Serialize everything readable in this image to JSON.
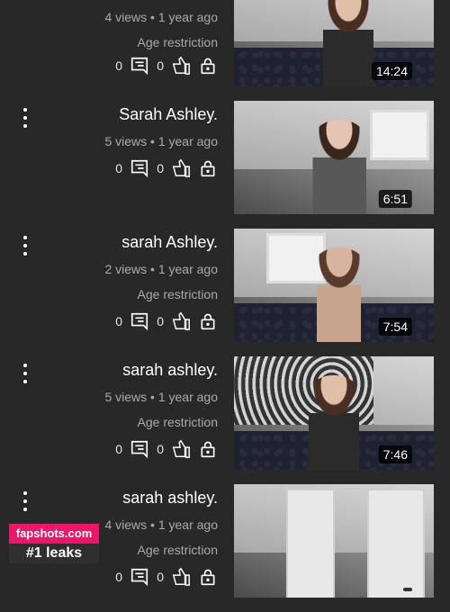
{
  "rows": [
    {
      "title": "",
      "views": "4 views • 1 year ago",
      "restriction": "Age restriction",
      "duration": "14:24",
      "comments": "0",
      "likes": "0"
    },
    {
      "title": "Sarah Ashley.",
      "views": "5 views • 1 year ago",
      "restriction": "",
      "duration": "6:51",
      "comments": "0",
      "likes": "0"
    },
    {
      "title": "sarah Ashley.",
      "views": "2 views • 1 year ago",
      "restriction": "Age restriction",
      "duration": "7:54",
      "comments": "0",
      "likes": "0"
    },
    {
      "title": "sarah ashley.",
      "views": "5 views • 1 year ago",
      "restriction": "Age restriction",
      "duration": "7:46",
      "comments": "0",
      "likes": "0"
    },
    {
      "title": "sarah ashley.",
      "views": "4 views • 1 year ago",
      "restriction": "Age restriction",
      "duration": "",
      "comments": "0",
      "likes": "0"
    }
  ],
  "watermark": {
    "site": "fapshots.com",
    "tagline": "#1 leaks"
  },
  "colors": {
    "background": "#282828",
    "text_primary": "#ffffff",
    "text_secondary": "#aaaaaa",
    "watermark_pink": "#e8196a"
  },
  "icons": [
    "more-vert-icon",
    "comment-icon",
    "thumb-up-icon",
    "lock-icon"
  ]
}
